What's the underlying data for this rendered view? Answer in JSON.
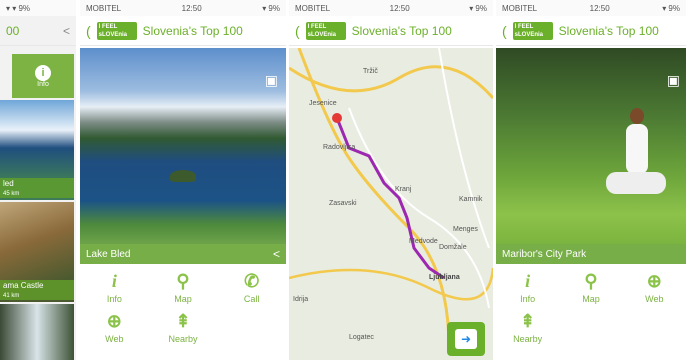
{
  "panel1": {
    "header_left": "00",
    "info_label": "Info",
    "thumbs": [
      {
        "label": "led",
        "dist": "45 km"
      },
      {
        "label": "ama Castle",
        "dist": "41 km"
      },
      {
        "label": "",
        "dist": ""
      }
    ]
  },
  "panel2": {
    "carrier": "MOBITEL",
    "time": "12:50",
    "app_title": "Slovenia's Top 100",
    "caption": "Lake Bled",
    "actions": [
      {
        "icon": "i",
        "label": "Info"
      },
      {
        "icon": "⚲",
        "label": "Map"
      },
      {
        "icon": "✆",
        "label": "Call"
      },
      {
        "icon": "⊕",
        "label": "Web"
      },
      {
        "icon": "⇞",
        "label": "Nearby"
      }
    ]
  },
  "panel3": {
    "carrier": "MOBITEL",
    "time": "12:50",
    "app_title": "Slovenia's Top 100",
    "places": [
      "Jesenice",
      "Radovljica",
      "Kranj",
      "Ljubljana",
      "Idrija",
      "Logatec",
      "Kamnik",
      "Domžale",
      "Zasavski",
      "Menges",
      "Medvode",
      "Tržič"
    ]
  },
  "panel4": {
    "carrier": "MOBITEL",
    "time": "12:50",
    "app_title": "Slovenia's Top 100",
    "caption": "Maribor's City Park",
    "actions": [
      {
        "icon": "i",
        "label": "Info"
      },
      {
        "icon": "⚲",
        "label": "Map"
      },
      {
        "icon": "⊕",
        "label": "Web"
      },
      {
        "icon": "⇞",
        "label": "Nearby"
      }
    ]
  },
  "colors": {
    "accent": "#6bb02a"
  }
}
